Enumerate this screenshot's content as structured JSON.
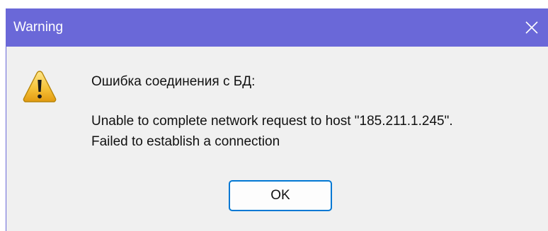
{
  "window": {
    "title": "Warning",
    "titlebar_color": "#6a68d8",
    "close_icon": "close-icon"
  },
  "message": {
    "icon": "warning-icon",
    "heading": "Ошибка соединения с БД:",
    "lines": [
      "Unable to complete network request to host \"185.211.1.245\".",
      "Failed to establish a connection"
    ]
  },
  "buttons": {
    "ok_label": "OK",
    "focus_color": "#0078d4"
  }
}
